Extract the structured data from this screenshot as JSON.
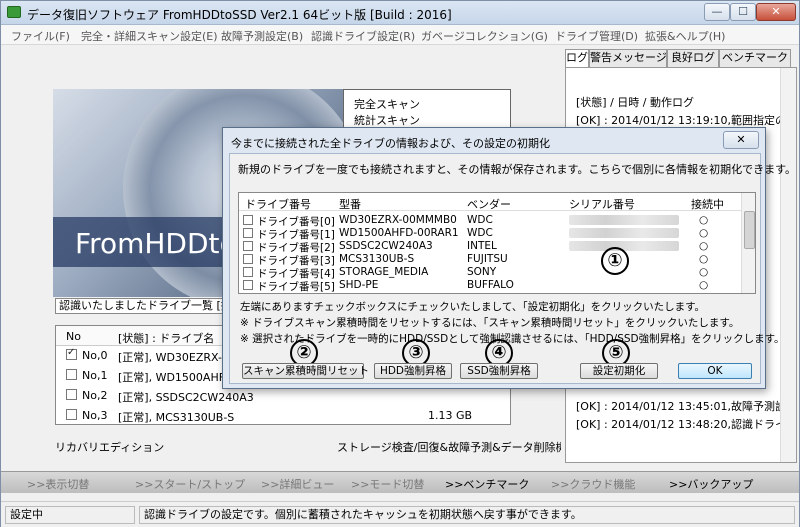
{
  "window": {
    "title": "データ復旧ソフトウェア FromHDDtoSSD Ver2.1 64ビット版 [Build : 2016]",
    "min": "—",
    "max": "☐",
    "close": "✕"
  },
  "menu": [
    "ファイル(F)",
    "完全・詳細スキャン設定(E)",
    "故障予測設定(B)",
    "認識ドライブ設定(R)",
    "ガベージコレクション(G)",
    "ドライブ管理(D)",
    "拡張&ヘルプ(H)"
  ],
  "logo_text": "FromHDDto",
  "scan_panel": [
    "完全スキャン",
    "統計スキャン"
  ],
  "drive_list_label": "認識いたしましたドライブ一覧 [接続無",
  "main_list": {
    "headers": [
      "No",
      "[状態] : ドライブ名"
    ],
    "rows": [
      {
        "no": "No,0",
        "text": "[正常], WD30EZRX-0",
        "checked": true
      },
      {
        "no": "No,1",
        "text": "[正常], WD1500AHFD",
        "checked": false
      },
      {
        "no": "No,2",
        "text": "[正常], SSDSC2CW240A3",
        "checked": false
      },
      {
        "no": "No,3",
        "text": "[正常], MCS3130UB-S",
        "checked": false
      }
    ],
    "extra": "1.13 GB"
  },
  "footer_left": "リカバリエディション",
  "footer_right": "ストレージ検査/回復&故障予測&データ削除機能",
  "log": {
    "tabs": [
      "ログ",
      "警告メッセージ",
      "良好ログ",
      "ベンチマーク"
    ],
    "header": "[状態] / 日時 / 動作ログ",
    "lines": [
      "[OK] : 2014/01/12 13:19:10,範囲指定の",
      "[OK] : 2014/01/12 13:45:01,故障予測設",
      "[OK] : 2014/01/12 13:48:20,認識ドライ"
    ]
  },
  "bottom_buttons": [
    {
      "label": ">>表示切替",
      "on": false
    },
    {
      "label": ">>スタート/ストップ",
      "on": false
    },
    {
      "label": ">>詳細ビュー",
      "on": false
    },
    {
      "label": ">>モード切替",
      "on": false
    },
    {
      "label": ">>ベンチマーク",
      "on": true
    },
    {
      "label": ">>クラウド機能",
      "on": false
    },
    {
      "label": ">>バックアップ",
      "on": true
    }
  ],
  "status": {
    "left": "設定中",
    "right": "認識ドライブの設定です。個別に蓄積されたキャッシュを初期状態へ戻す事ができます。"
  },
  "dialog": {
    "title": "今までに接続された全ドライブの情報および、その設定の初期化",
    "close": "✕",
    "description": "新規のドライブを一度でも接続されますと、その情報が保存されます。こちらで個別に各情報を初期化できます。",
    "headers": [
      "ドライブ番号",
      "型番",
      "ベンダー",
      "シリアル番号",
      "接続中"
    ],
    "rows": [
      {
        "drive": "ドライブ番号[0]",
        "model": "WD30EZRX-00MMMB0",
        "vendor": "WDC",
        "connected": "○"
      },
      {
        "drive": "ドライブ番号[1]",
        "model": "WD1500AHFD-00RAR1",
        "vendor": "WDC",
        "connected": "○"
      },
      {
        "drive": "ドライブ番号[2]",
        "model": "SSDSC2CW240A3",
        "vendor": "INTEL",
        "connected": "○"
      },
      {
        "drive": "ドライブ番号[3]",
        "model": "MCS3130UB-S",
        "vendor": "FUJITSU",
        "connected": "○"
      },
      {
        "drive": "ドライブ番号[4]",
        "model": "STORAGE_MEDIA",
        "vendor": "SONY",
        "connected": "○"
      },
      {
        "drive": "ドライブ番号[5]",
        "model": "SHD-PE",
        "vendor": "BUFFALO",
        "connected": "○"
      }
    ],
    "notes": [
      "左端にありますチェックボックスにチェックいたしまして、「設定初期化」をクリックいたします。",
      "※ ドライブスキャン累積時間をリセットするには、「スキャン累積時間リセット」をクリックいたします。",
      "※ 選択されたドライブを一時的にHDD/SSDとして強制認識させるには、「HDD/SSD強制昇格」をクリックします。"
    ],
    "buttons": {
      "scan_reset": "スキャン累積時間リセット",
      "hdd_force": "HDD強制昇格",
      "ssd_force": "SSD強制昇格",
      "init": "設定初期化",
      "ok": "OK"
    },
    "markers": [
      "①",
      "②",
      "③",
      "④",
      "⑤"
    ]
  }
}
